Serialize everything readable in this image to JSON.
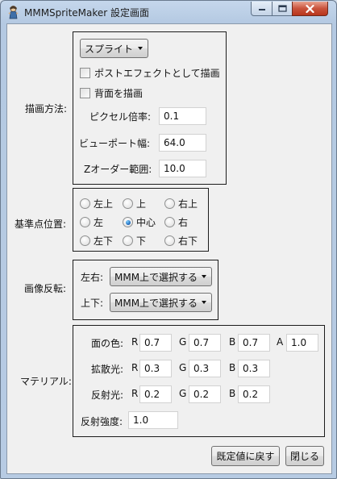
{
  "window": {
    "title": "MMMSpriteMaker 設定画面",
    "minimize_icon": "minimize-icon",
    "maximize_icon": "maximize-icon",
    "close_icon": "close-icon"
  },
  "render": {
    "label": "描画方法:",
    "mode_value": "スプライト",
    "post_effect_label": "ポストエフェクトとして描画",
    "post_effect_checked": false,
    "background_label": "背面を描画",
    "background_checked": false,
    "pixel_ratio_label": "ピクセル倍率:",
    "pixel_ratio_value": "0.1",
    "viewport_label": "ビューポート幅:",
    "viewport_value": "64.0",
    "zorder_label": "Zオーダー範囲:",
    "zorder_value": "10.0"
  },
  "anchor": {
    "label": "基準点位置:",
    "options": [
      "左上",
      "上",
      "右上",
      "左",
      "中心",
      "右",
      "左下",
      "下",
      "右下"
    ],
    "selected": "中心"
  },
  "flip": {
    "label": "画像反転:",
    "lr_label": "左右:",
    "lr_value": "MMM上で選択する",
    "ud_label": "上下:",
    "ud_value": "MMM上で選択する"
  },
  "material": {
    "label": "マテリアル:",
    "face_color_label": "面の色:",
    "diffuse_label": "拡散光:",
    "specular_label": "反射光:",
    "shininess_label": "反射強度:",
    "r": "R",
    "g": "G",
    "b": "B",
    "a": "A",
    "face": {
      "r": "0.7",
      "g": "0.7",
      "b": "0.7",
      "a": "1.0"
    },
    "diffuse": {
      "r": "0.3",
      "g": "0.3",
      "b": "0.3"
    },
    "specular": {
      "r": "0.2",
      "g": "0.2",
      "b": "0.2"
    },
    "shininess": "1.0"
  },
  "buttons": {
    "reset": "既定値に戻す",
    "close": "閉じる"
  }
}
